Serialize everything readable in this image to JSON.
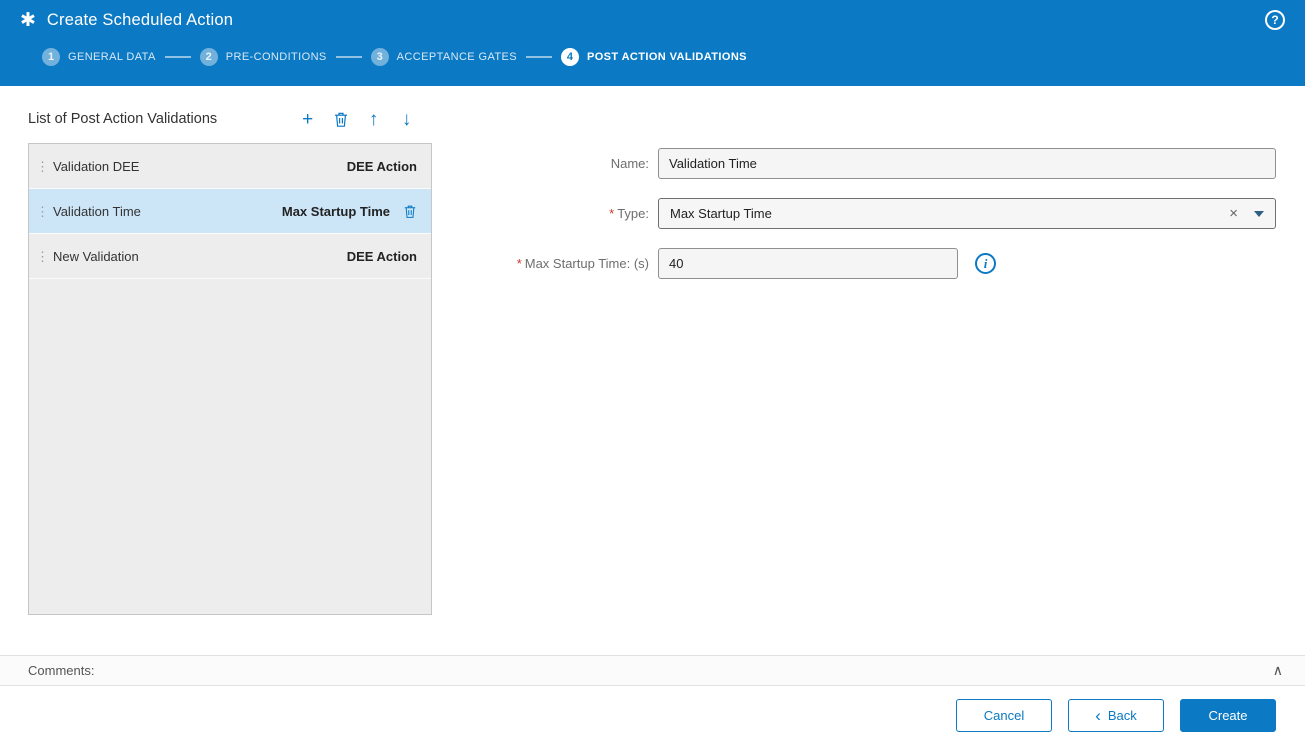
{
  "header": {
    "title": "Create Scheduled Action",
    "app_icon": "✱",
    "help_icon": "?"
  },
  "wizard": {
    "steps": [
      {
        "number": "1",
        "label": "GENERAL DATA",
        "active": false
      },
      {
        "number": "2",
        "label": "PRE-CONDITIONS",
        "active": false
      },
      {
        "number": "3",
        "label": "ACCEPTANCE GATES",
        "active": false
      },
      {
        "number": "4",
        "label": "POST ACTION VALIDATIONS",
        "active": true
      }
    ]
  },
  "list_panel": {
    "title": "List of Post Action Validations",
    "items": [
      {
        "name": "Validation DEE",
        "type": "DEE Action",
        "selected": false
      },
      {
        "name": "Validation Time",
        "type": "Max Startup Time",
        "selected": true
      },
      {
        "name": "New Validation",
        "type": "DEE Action",
        "selected": false
      }
    ]
  },
  "form": {
    "required_marker": "*",
    "name": {
      "label": "Name:",
      "value": "Validation Time"
    },
    "type": {
      "label": "Type:",
      "value": "Max Startup Time",
      "clear_icon": "×"
    },
    "max_startup_time": {
      "label": "Max Startup Time: (s)",
      "value": "40",
      "info_icon": "i"
    }
  },
  "comments": {
    "label": "Comments:",
    "collapse_icon": "∧"
  },
  "footer": {
    "cancel_label": "Cancel",
    "back_chevron": "‹",
    "back_label": "Back",
    "create_label": "Create"
  },
  "colors": {
    "accent": "#0b79c3",
    "selected_row": "#cde6f7",
    "required": "#c8372d"
  }
}
